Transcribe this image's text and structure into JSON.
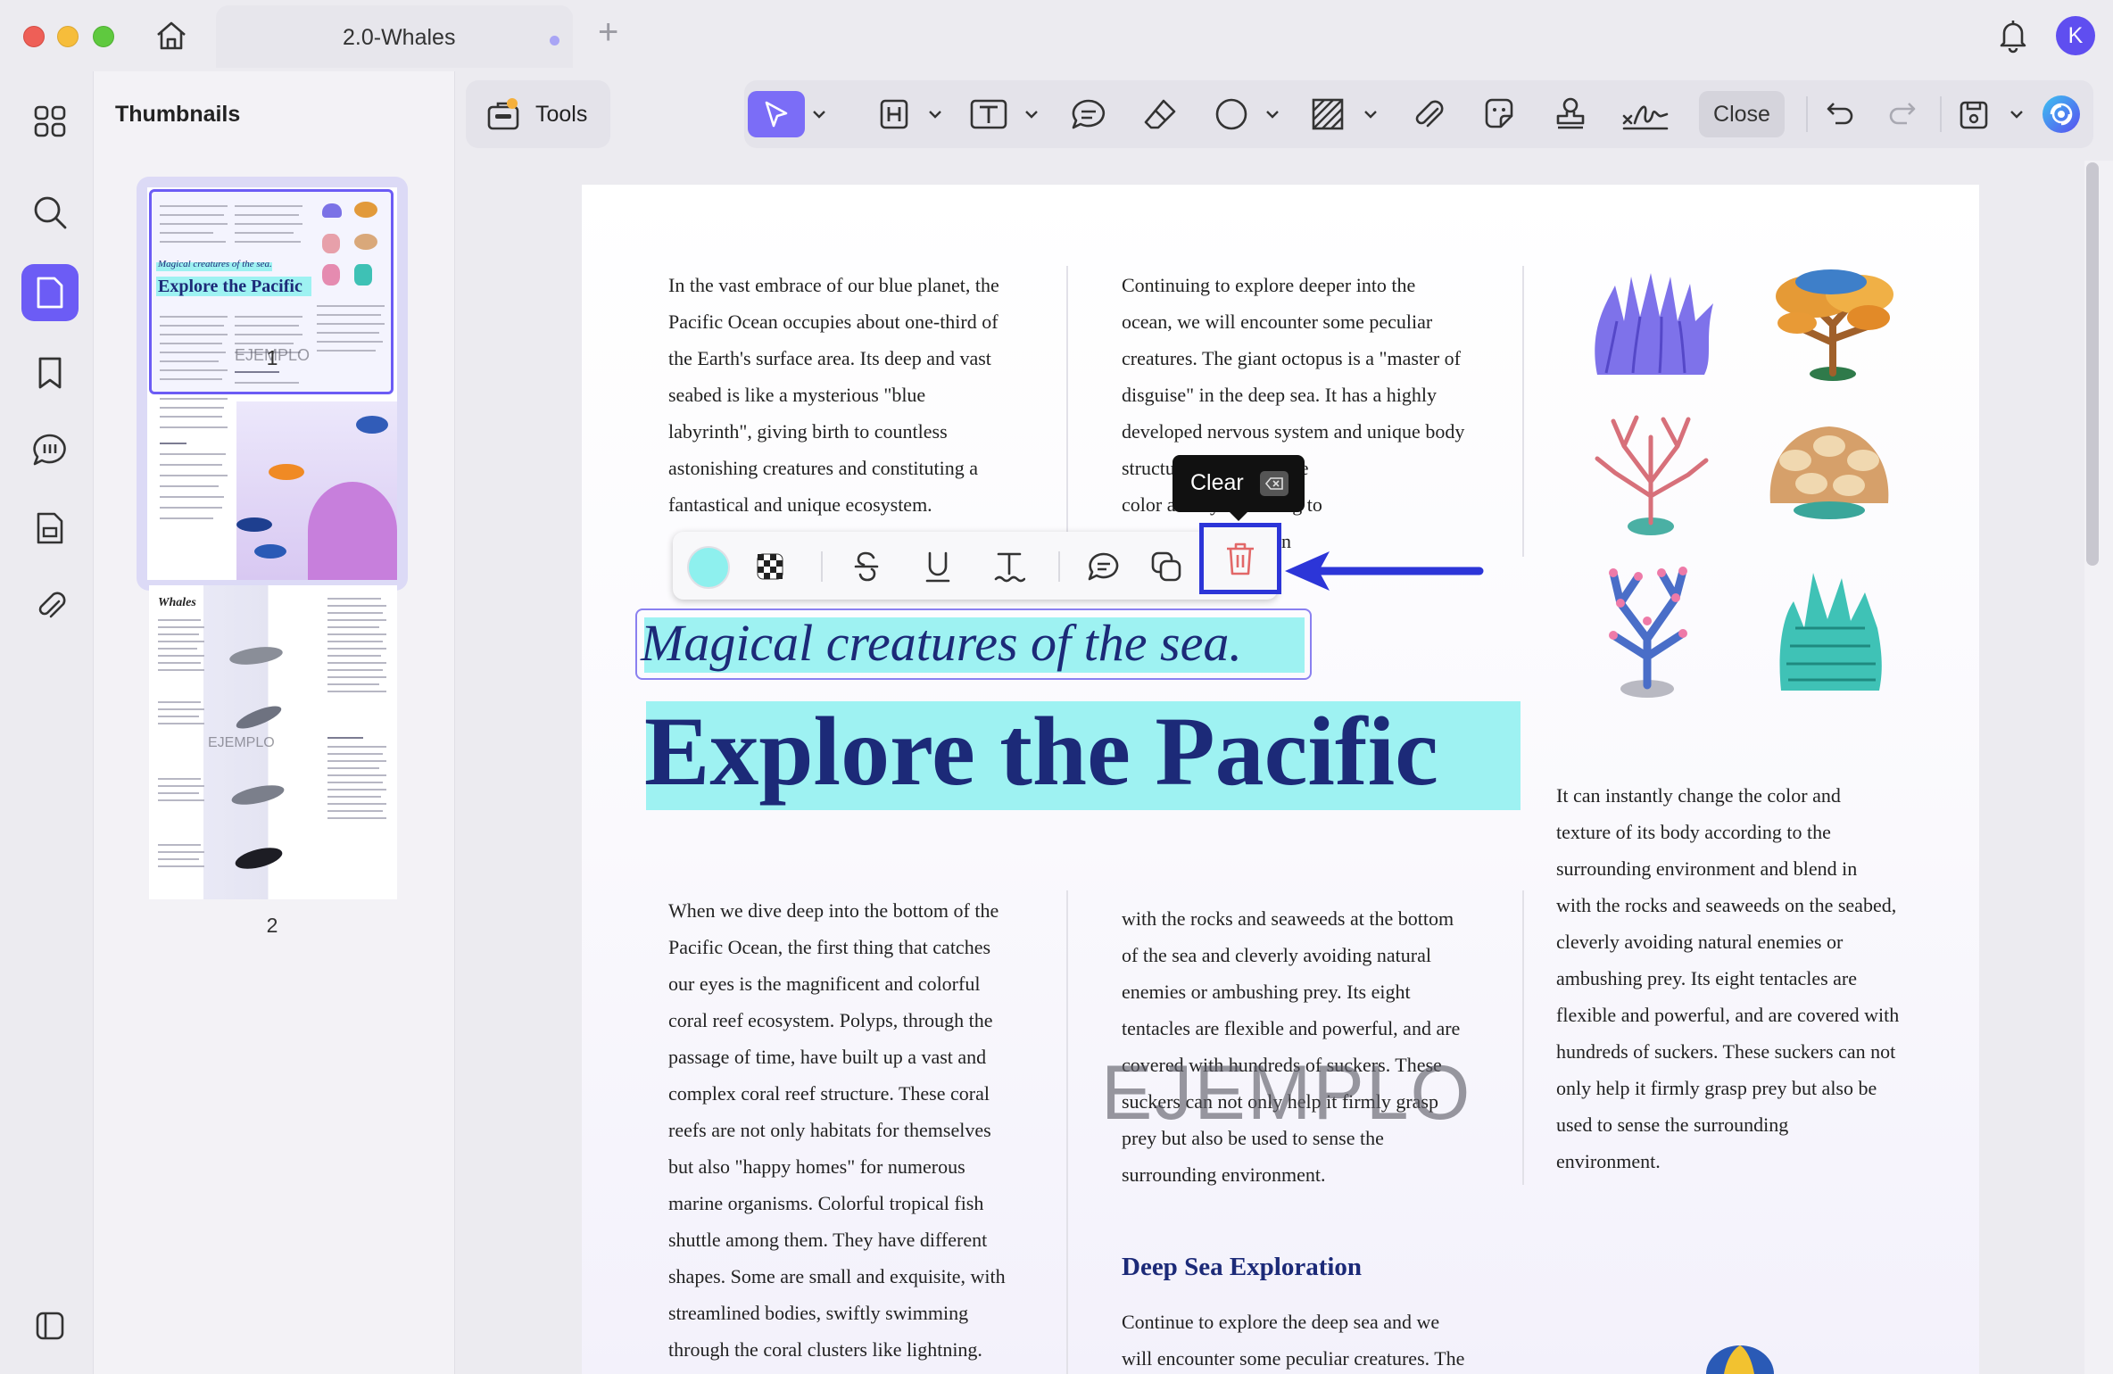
{
  "window": {
    "tab_title": "2.0-Whales",
    "new_tab": "+",
    "user_initial": "K"
  },
  "thumbnails": {
    "title": "Thumbnails",
    "pages": [
      {
        "number": "1",
        "title": "Explore the Pacific",
        "subtitle": "Magical creatures of the sea.",
        "watermark": "EJEMPLO"
      },
      {
        "number": "2",
        "title": "Whales",
        "watermark": "EJEMPLO"
      }
    ]
  },
  "toolbar": {
    "tools_label": "Tools",
    "close_label": "Close",
    "selected_tool": "select-tool"
  },
  "markup_toolbar": {
    "highlight_color": "#8ef0ee",
    "tooltip_label": "Clear"
  },
  "document": {
    "col1_top": "In the vast embrace of our blue planet, the\nPacific Ocean occupies about one-third of\nthe Earth's surface area. Its deep and vast\nseabed is like a mysterious \"blue\nlabyrinth\", giving birth to countless\nastonishing creatures and constituting a\nfantastical and unique ecosystem.",
    "col2_top": "Continuing to explore deeper into the\nocean, we will encounter some peculiar\ncreatures. The giant octopus is a \"master of\ndisguise\" in the deep sea. It has a highly\ndeveloped nervous system and unique body\nstructu                   antly change the\ncolor a                      body according to\n                                     ironment, blending in",
    "subtitle": "Magical creatures of the sea.",
    "title": "Explore the Pacific",
    "col3_mid": "It can instantly change the color and\ntexture of its body according to the\nsurrounding environment and blend in\nwith the rocks and seaweeds on the seabed,\ncleverly avoiding natural enemies or\nambushing prey. Its eight tentacles are\nflexible and powerful, and are covered with\nhundreds of suckers. These suckers can not\nonly help it firmly grasp prey but also be\nused to sense the surrounding\nenvironment.",
    "col1_bottom": "When we dive deep into the bottom of the\nPacific Ocean, the first thing that catches\nour eyes is the magnificent and colorful\ncoral reef ecosystem. Polyps, through the\npassage of time, have built up a vast and\ncomplex coral reef structure. These coral\nreefs are not only habitats for themselves\nbut also \"happy homes\" for numerous\nmarine organisms. Colorful tropical fish\nshuttle among them. They have different\nshapes. Some are small and exquisite, with\nstreamlined bodies, swiftly swimming\nthrough the coral clusters like lightning.",
    "col2_bottom": "with the rocks and seaweeds at the bottom\nof the sea and cleverly avoiding natural\nenemies or ambushing prey. Its eight\ntentacles are flexible and powerful, and are\ncovered with hundreds of suckers. These\nsuckers can not only help it firmly grasp\nprey but also be used to sense the\nsurrounding environment.",
    "section_heading": "Deep Sea Exploration",
    "col2_section": "Continue to explore the deep sea and we\nwill encounter some peculiar creatures. The",
    "watermark": "EJEMPLO"
  },
  "colors": {
    "accent": "#6c5cf5",
    "highlight": "#9ef2f2",
    "title_navy": "#1c2a78",
    "annotation_blue": "#2c35d8"
  }
}
